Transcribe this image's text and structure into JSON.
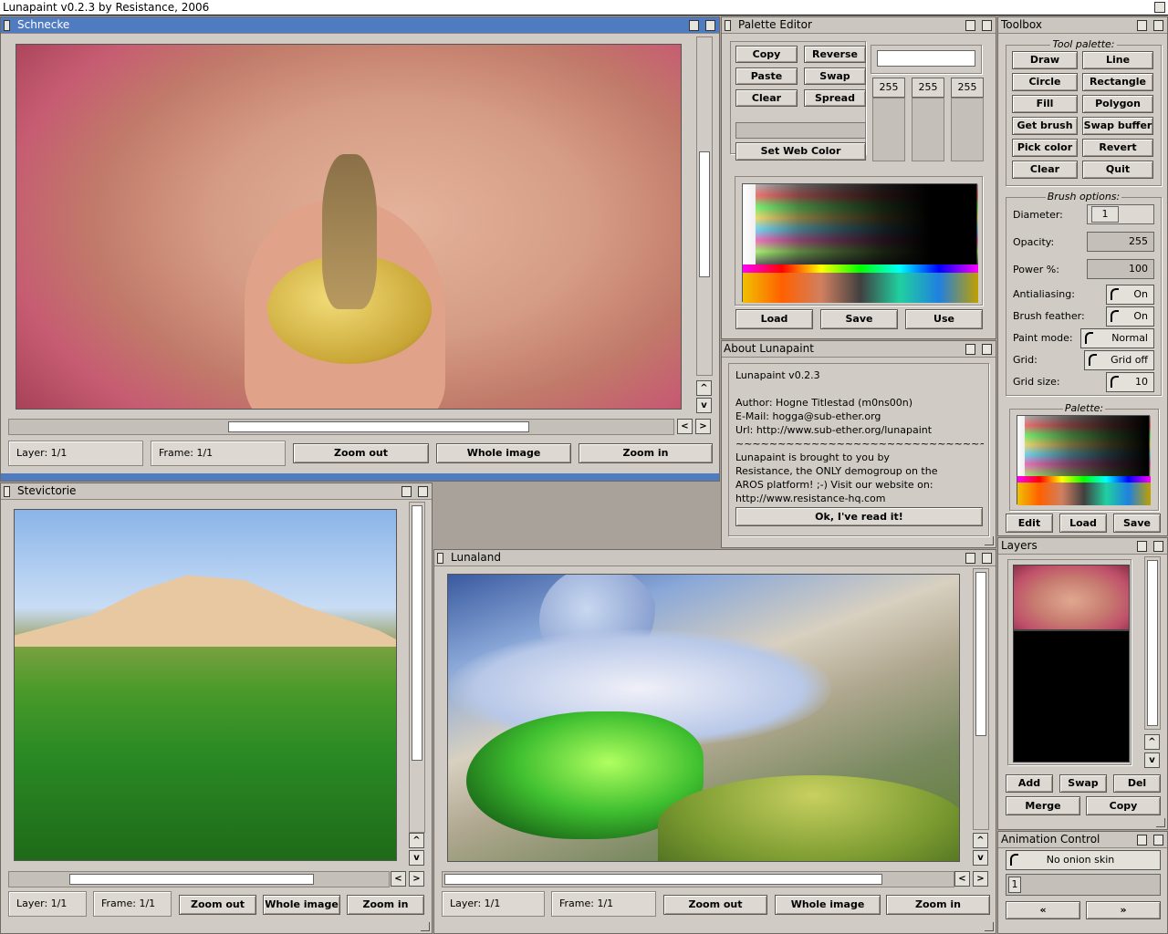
{
  "screen_title": "Lunapaint v0.2.3 by Resistance, 2006",
  "canvas_windows": [
    {
      "title": "Schnecke",
      "layer": "Layer: 1/1",
      "frame": "Frame: 1/1",
      "zoom_out": "Zoom out",
      "whole_image": "Whole image",
      "zoom_in": "Zoom in"
    },
    {
      "title": "Stevictorie",
      "layer": "Layer: 1/1",
      "frame": "Frame: 1/1",
      "zoom_out": "Zoom out",
      "whole_image": "Whole image",
      "zoom_in": "Zoom in"
    },
    {
      "title": "Lunaland",
      "layer": "Layer: 1/1",
      "frame": "Frame: 1/1",
      "zoom_out": "Zoom out",
      "whole_image": "Whole image",
      "zoom_in": "Zoom in"
    }
  ],
  "scroll_arrows": {
    "up": "^",
    "down": "v",
    "left": "<",
    "right": ">"
  },
  "palette_editor": {
    "title": "Palette Editor",
    "buttons": [
      "Copy",
      "Reverse",
      "Paste",
      "Swap",
      "Clear",
      "Spread"
    ],
    "set_web_color": "Set Web Color",
    "rgb": [
      "255",
      "255",
      "255"
    ],
    "load": "Load",
    "save": "Save",
    "use": "Use"
  },
  "about": {
    "title": "About Lunapaint",
    "lines": [
      "Lunapaint v0.2.3",
      "",
      "Author: Hogne Titlestad (m0ns00n)",
      "E-Mail: hogga@sub-ether.org",
      "Url: http://www.sub-ether.org/lunapaint",
      "~~~~~~~~~~~~~~~~~~~~~~~~~~~~~~",
      "Lunapaint is brought to you by",
      "Resistance, the ONLY demogroup on the",
      "AROS platform! ;-) Visit our website on:",
      "http://www.resistance-hq.com"
    ],
    "ok_button": "Ok, I've read it!"
  },
  "toolbox": {
    "title": "Toolbox",
    "tool_palette_label": "Tool palette:",
    "tools": [
      "Draw",
      "Line",
      "Circle",
      "Rectangle",
      "Fill",
      "Polygon",
      "Get brush",
      "Swap buffer",
      "Pick color",
      "Revert",
      "Clear",
      "Quit"
    ],
    "brush_options_label": "Brush options:",
    "options": [
      {
        "label": "Diameter:",
        "value": "1",
        "kind": "input"
      },
      {
        "label": "Opacity:",
        "value": "255",
        "kind": "number"
      },
      {
        "label": "Power %:",
        "value": "100",
        "kind": "number"
      },
      {
        "label": "Antialiasing:",
        "value": "On",
        "kind": "cycle"
      },
      {
        "label": "Brush feather:",
        "value": "On",
        "kind": "cycle"
      },
      {
        "label": "Paint mode:",
        "value": "Normal",
        "kind": "cycle"
      },
      {
        "label": "Grid:",
        "value": "Grid off",
        "kind": "cycle"
      },
      {
        "label": "Grid size:",
        "value": "10",
        "kind": "cycle"
      }
    ],
    "palette_label": "Palette:",
    "edit": "Edit",
    "load": "Load",
    "save": "Save"
  },
  "layers": {
    "title": "Layers",
    "add": "Add",
    "swap": "Swap",
    "del": "Del",
    "merge": "Merge",
    "copy": "Copy"
  },
  "animation": {
    "title": "Animation Control",
    "onion": "No onion skin",
    "frame_value": "1",
    "prev": "«",
    "next": "»"
  }
}
